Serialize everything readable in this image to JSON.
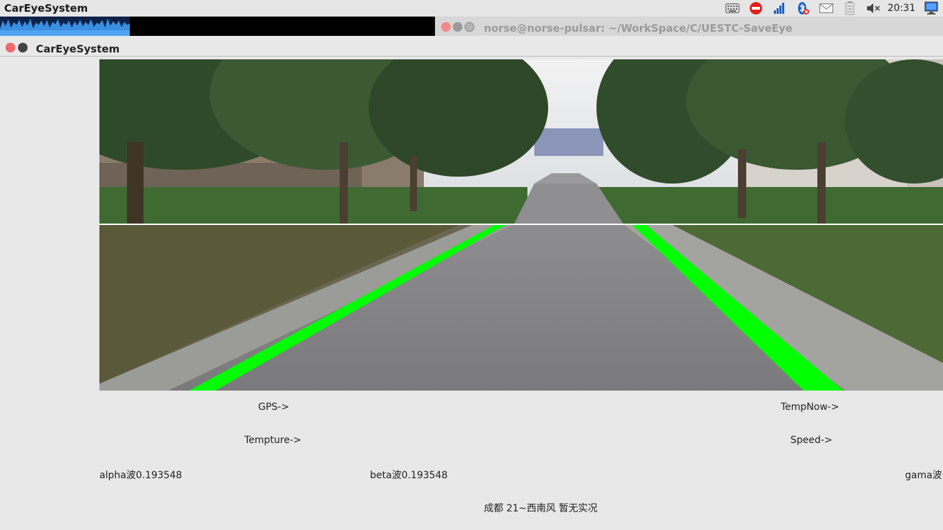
{
  "panel": {
    "app_name": "CarEyeSystem",
    "clock": "20:31",
    "tray_icons": [
      "keyboard-icon",
      "no-entry-icon",
      "signal-bars-icon",
      "bluetooth-off-icon",
      "mail-icon",
      "battery-icon",
      "volume-muted-icon",
      "computer-icon"
    ]
  },
  "terminal": {
    "title": "norse@norse-pulsar: ~/WorkSpace/C/UESTC-SaveEye"
  },
  "window": {
    "title": "CarEyeSystem"
  },
  "readouts": {
    "gps": "GPS->",
    "temperature": "Tempture->",
    "temp_now": "TempNow->",
    "speed": "Speed->",
    "alpha": "alpha波0.193548",
    "beta": "beta波0.193548",
    "gama": "gama波(",
    "weather": "成都 21~西南风 暂无实况"
  },
  "colors": {
    "lane": "#00ff00",
    "close_button": "#f08b8b"
  }
}
